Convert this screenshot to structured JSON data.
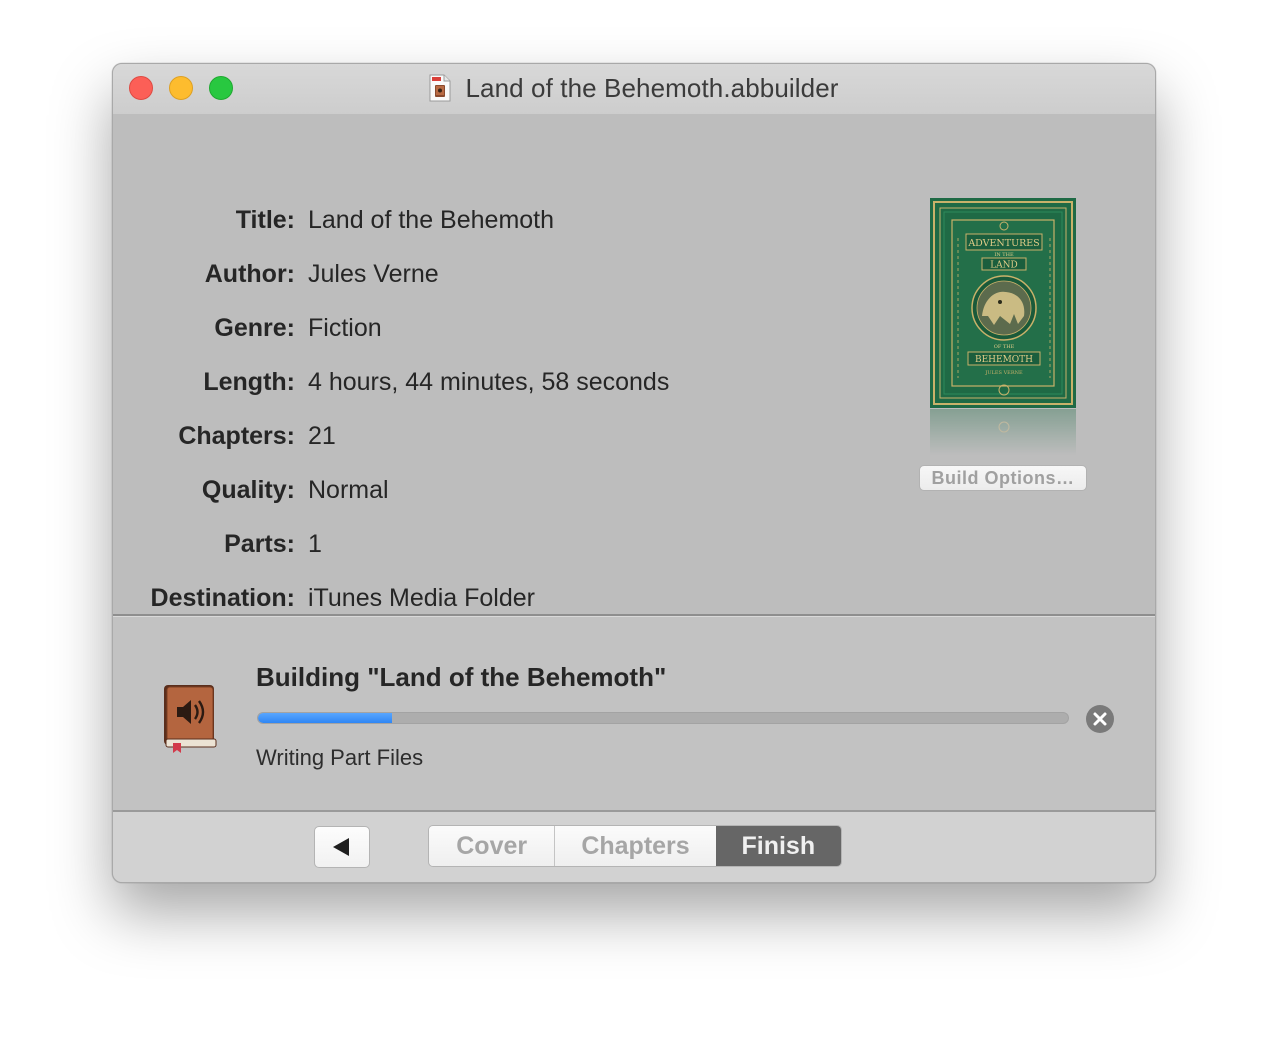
{
  "window": {
    "title": "Land of the Behemoth.abbuilder"
  },
  "info": [
    {
      "label": "Title:",
      "value": "Land of the Behemoth"
    },
    {
      "label": "Author:",
      "value": "Jules Verne"
    },
    {
      "label": "Genre:",
      "value": "Fiction"
    },
    {
      "label": "Length:",
      "value": "4 hours, 44 minutes, 58 seconds"
    },
    {
      "label": "Chapters:",
      "value": "21"
    },
    {
      "label": "Quality:",
      "value": "Normal"
    },
    {
      "label": "Parts:",
      "value": "1"
    },
    {
      "label": "Destination:",
      "value": "iTunes Media Folder"
    }
  ],
  "cover": {
    "line1": "ADVENTURES",
    "line2": "IN THE",
    "line3": "LAND",
    "line4": "OF THE",
    "line5": "BEHEMOTH",
    "line6": "JULES VERNE"
  },
  "build_options_label": "Build Options…",
  "progress": {
    "title": "Building \"Land of the Behemoth\"",
    "status": "Writing Part Files",
    "fraction": 0.165
  },
  "nav": {
    "back_glyph": "◀",
    "tabs": [
      "Cover",
      "Chapters",
      "Finish"
    ],
    "selected_tab": "Finish"
  },
  "colors": {
    "progress_fill": "#2f86f5",
    "cover_green": "#1f6a45",
    "cover_gold": "#c9b26a",
    "selected_tab_bg": "#666666"
  }
}
